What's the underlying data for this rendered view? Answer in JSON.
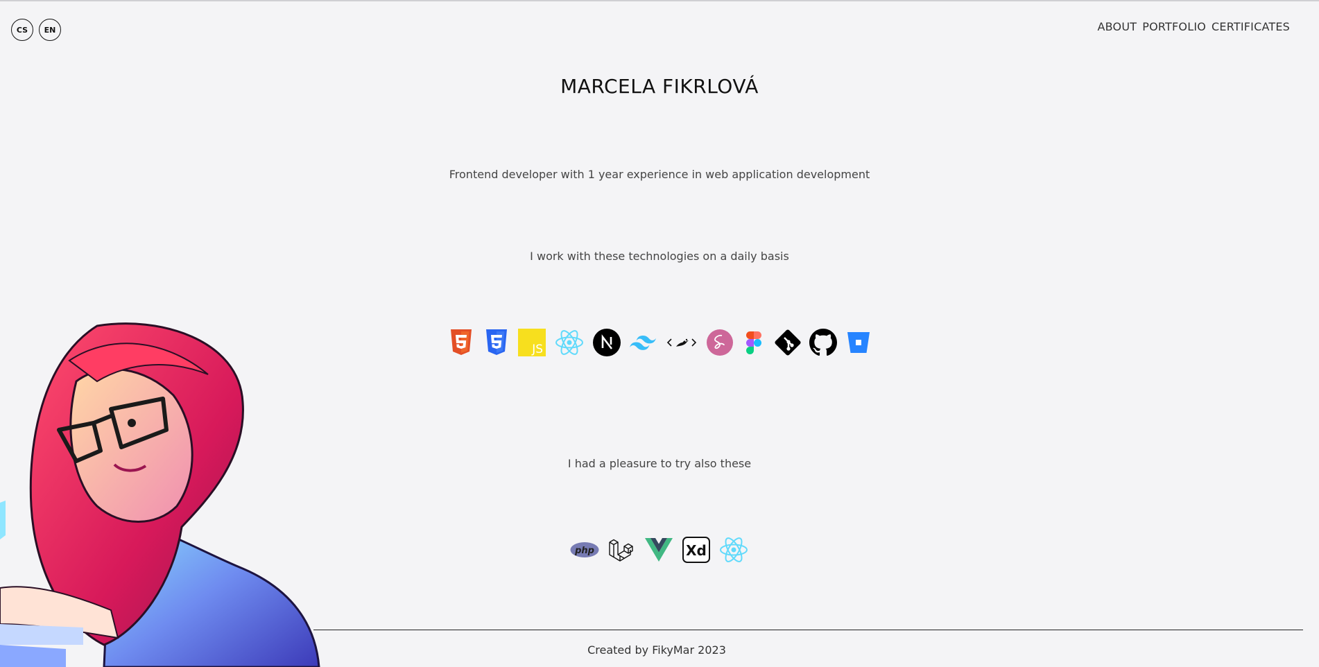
{
  "lang": {
    "cs": "CS",
    "en": "EN"
  },
  "nav": [
    "ABOUT",
    "PORTFOLIO",
    "CERTIFICATES"
  ],
  "title": "MARCELA FIKRLOVÁ",
  "tagline": "Frontend developer with 1 year experience in web application development",
  "daily_heading": "I work with these technologies on a daily basis",
  "daily_tech": [
    "html5-icon",
    "css3-icon",
    "javascript-icon",
    "react-icon",
    "nextjs-icon",
    "tailwind-icon",
    "styled-components-icon",
    "sass-icon",
    "figma-icon",
    "git-icon",
    "github-icon",
    "bitbucket-icon"
  ],
  "tried_heading": "I had a pleasure to try also these",
  "tried_tech": [
    "php-icon",
    "laravel-icon",
    "vue-icon",
    "adobe-xd-icon",
    "react-native-icon"
  ],
  "tech_labels": {
    "php": "php",
    "js": "JS",
    "xd": "Xd"
  },
  "footer": "Created by FikyMar 2023",
  "colors": {
    "background": "#f4f4f6",
    "html": "#e34f26",
    "css": "#2965f1",
    "js": "#f7df1e",
    "react": "#61dafb",
    "sass": "#cd6799",
    "vue": "#41b883",
    "bitbucket": "#2684ff"
  }
}
